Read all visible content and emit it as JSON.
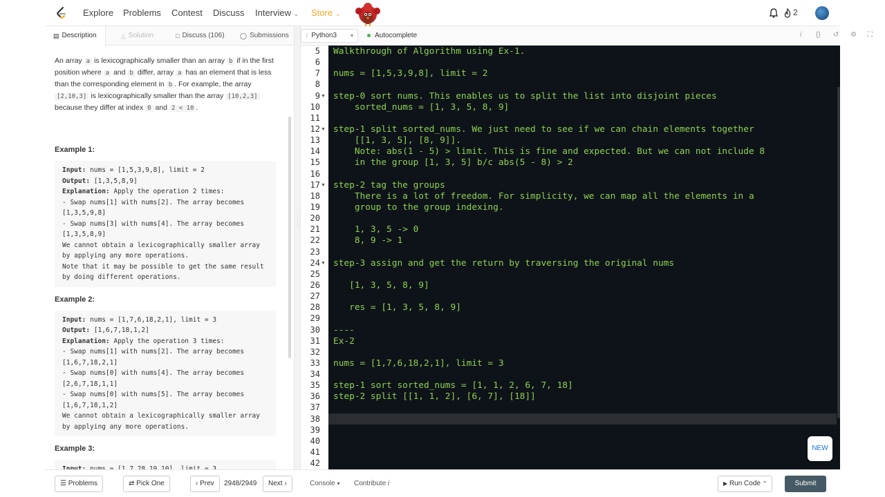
{
  "nav": {
    "items": [
      "Explore",
      "Problems",
      "Contest",
      "Discuss",
      "Interview",
      "Store"
    ],
    "streak_count": "2"
  },
  "left_tabs": [
    "Description",
    "Solution",
    "Discuss (106)",
    "Submissions"
  ],
  "editor_toolbar": {
    "language": "Python3",
    "autocomplete": "Autocomplete"
  },
  "description": {
    "intro_parts": [
      "An array ",
      "a",
      " is lexicographically smaller than an array ",
      "b",
      " if in the first position where ",
      "a",
      " and ",
      "b",
      " differ, array ",
      "a",
      " has an element that is less than the corresponding element in ",
      "b",
      ". For example, the array ",
      "[2,10,3]",
      " is lexicographically smaller than the array ",
      "[10,2,3]",
      " because they differ at index ",
      "0",
      " and ",
      "2 < 10",
      "."
    ],
    "examples": [
      {
        "title": "Example 1:",
        "lines": [
          "Input: nums = [1,5,3,9,8], limit = 2",
          "Output: [1,3,5,8,9]",
          "Explanation: Apply the operation 2 times:",
          "- Swap nums[1] with nums[2]. The array becomes",
          "[1,3,5,9,8]",
          "- Swap nums[3] with nums[4]. The array becomes",
          "[1,3,5,8,9]",
          "We cannot obtain a lexicographically smaller array",
          "by applying any more operations.",
          "Note that it may be possible to get the same result",
          "by doing different operations."
        ]
      },
      {
        "title": "Example 2:",
        "lines": [
          "Input: nums = [1,7,6,18,2,1], limit = 3",
          "Output: [1,6,7,18,1,2]",
          "Explanation: Apply the operation 3 times:",
          "- Swap nums[1] with nums[2]. The array becomes",
          "[1,6,7,18,2,1]",
          "- Swap nums[0] with nums[4]. The array becomes",
          "[2,6,7,18,1,1]",
          "- Swap nums[0] with nums[5]. The array becomes",
          "[1,6,7,18,1,2]",
          "We cannot obtain a lexicographically smaller array",
          "by applying any more operations."
        ]
      },
      {
        "title": "Example 3:",
        "lines": [
          "Input: nums = [1,7,28,19,10], limit = 3"
        ]
      }
    ]
  },
  "code": {
    "first_line_number": 5,
    "fold_lines": [
      9,
      12,
      17,
      24
    ],
    "lines": [
      "Walkthrough of Algorithm using Ex-1.",
      "",
      "nums = [1,5,3,9,8], limit = 2",
      "",
      "step-0 sort nums. This enables us to split the list into disjoint pieces",
      "    sorted_nums = [1, 3, 5, 8, 9]",
      "",
      "step-1 split sorted_nums. We just need to see if we can chain elements together",
      "    [[1, 3, 5], [8, 9]].",
      "    Note: abs(1 - 5) > limit. This is fine and expected. But we can not include 8",
      "    in the group [1, 3, 5] b/c abs(5 - 8) > 2",
      "",
      "step-2 tag the groups",
      "    There is a lot of freedom. For simplicity, we can map all the elements in a",
      "    group to the group indexing.",
      "",
      "    1, 3, 5 -> 0",
      "    8, 9 -> 1",
      "",
      "step-3 assign and get the return by traversing the original nums",
      "",
      "   [1, 3, 5, 8, 9]",
      "",
      "   res = [1, 3, 5, 8, 9]",
      "",
      "----",
      "Ex-2",
      "",
      "nums = [1,7,6,18,2,1], limit = 3",
      "",
      "step-1 sort sorted_nums = [1, 1, 2, 6, 7, 18]",
      "step-2 split [[1, 1, 2], [6, 7], [18]]",
      "",
      "",
      "",
      "",
      "",
      ""
    ]
  },
  "new_badge": "NEW",
  "bottom": {
    "problems": "Problems",
    "pick_one": "Pick One",
    "prev": "Prev",
    "count": "2948/2949",
    "next": "Next",
    "console": "Console",
    "contribute": "Contribute",
    "run_code": "Run Code",
    "submit": "Submit"
  }
}
